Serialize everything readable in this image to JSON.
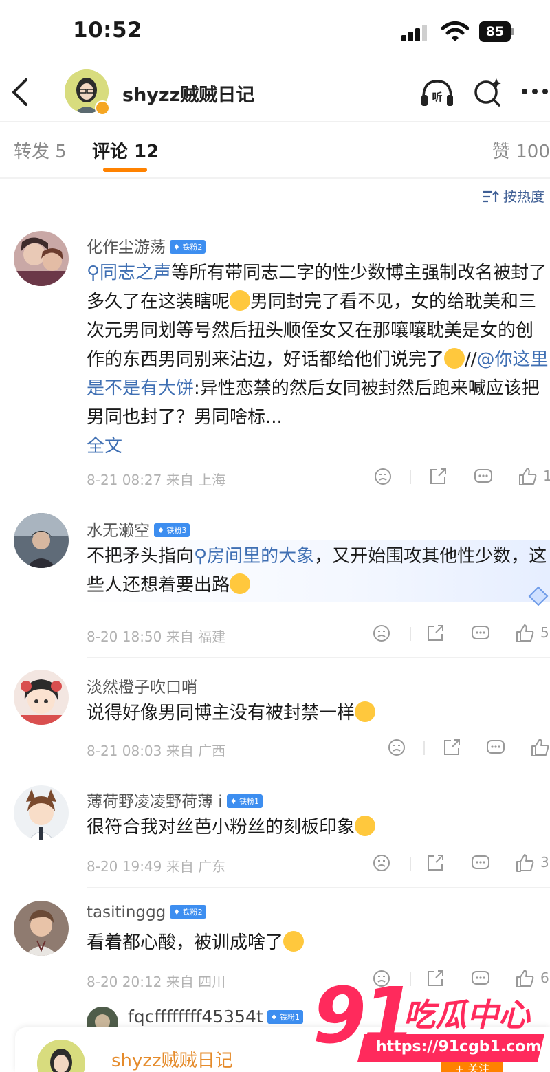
{
  "status_bar": {
    "time": "10:52",
    "battery": "85"
  },
  "header": {
    "account_name": "shyzz贼贼日记",
    "icons": [
      "back-icon",
      "listen-icon",
      "search-icon",
      "more-icon"
    ]
  },
  "tabs": {
    "repost": "转发 5",
    "comments": "评论 12",
    "likes": "赞 100"
  },
  "sort_label": "按热度",
  "comments": [
    {
      "name": "化作尘游荡",
      "badge": "铁粉2",
      "text_link": "同志之声",
      "text_1": "等所有带同志二字的性少数博主强制改名被封了多久了在这装瞎呢",
      "text_2": "男同封完了看不见，女的给耽美和三次元男同划等号然后扭头顺侄女又在那嚷嚷耽美是女的创作的东西男同别来沾边，好话都给他们说完了",
      "text_3": "//",
      "mention": "@你这里是不是有大饼",
      "text_4": ":异性恋禁的然后女同被封然后跑来喊应该把男同也封了？男同啥标...",
      "full_text": "全文",
      "meta": "8-21 08:27 来自 上海",
      "likes": "1"
    },
    {
      "name": "水无濑空",
      "badge": "铁粉3",
      "text_1": "不把矛头指向",
      "text_link": "房间里的大象",
      "text_2": "，又开始围攻其他性少数，这些人还想着要出路",
      "meta": "8-20 18:50 来自 福建",
      "likes": "5"
    },
    {
      "name": "淡然橙子吹口哨",
      "text_1": "说得好像男同博主没有被封禁一样",
      "meta": "8-21 08:03 来自 广西"
    },
    {
      "name": "薄荷野凌凌野荷薄 i",
      "badge": "铁粉1",
      "text_1": "很符合我对丝芭小粉丝的刻板印象",
      "meta": "8-20 19:49 来自 广东",
      "likes": "3"
    },
    {
      "name": "tasitinggg",
      "badge": "铁粉2",
      "text_1": "看着都心酸，被训成啥了",
      "meta": "8-20 20:12 来自 四川",
      "likes": "6"
    },
    {
      "name": "fqcffffffff45354t",
      "badge": "铁粉1"
    }
  ],
  "bottom_bar": {
    "name": "shyzz贼贼日记",
    "follow": "+ 关注"
  },
  "watermark": {
    "number": "91",
    "title": "吃瓜中心",
    "url": "https://91cgb1.com"
  },
  "colors": {
    "accent": "#ff8200",
    "link": "#3f6fb3",
    "fan_badge": "#3d8ef0",
    "watermark": "#ff2a5c"
  }
}
